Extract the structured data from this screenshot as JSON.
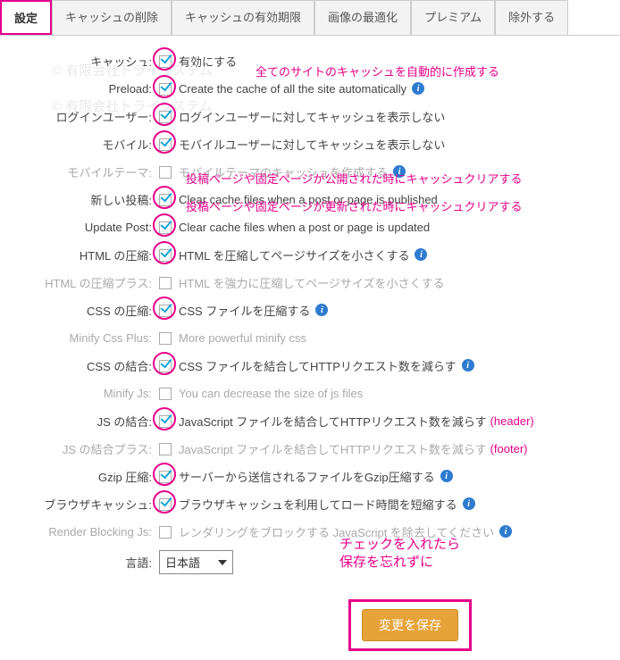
{
  "tabs": [
    {
      "label": "設定",
      "active": true
    },
    {
      "label": "キャッシュの削除",
      "active": false
    },
    {
      "label": "キャッシュの有効期限",
      "active": false
    },
    {
      "label": "画像の最適化",
      "active": false
    },
    {
      "label": "プレミアム",
      "active": false
    },
    {
      "label": "除外する",
      "active": false
    }
  ],
  "rows": [
    {
      "label": "キャッシュ:",
      "desc": "有効にする",
      "checked": true,
      "circled": true,
      "info": false,
      "disabled": false
    },
    {
      "label": "Preload:",
      "desc": "Create the cache of all the site automatically",
      "checked": true,
      "circled": true,
      "info": true,
      "disabled": false
    },
    {
      "label": "ログインユーザー:",
      "desc": "ログインユーザーに対してキャッシュを表示しない",
      "checked": true,
      "circled": true,
      "info": false,
      "disabled": false
    },
    {
      "label": "モバイル:",
      "desc": "モバイルユーザーに対してキャッシュを表示しない",
      "checked": true,
      "circled": true,
      "info": false,
      "disabled": false
    },
    {
      "label": "モバイルテーマ:",
      "desc": "モバイルテーマのキャッシュを作成する",
      "checked": false,
      "circled": false,
      "info": true,
      "disabled": true
    },
    {
      "label": "新しい投稿:",
      "desc": "Clear cache files when a post or page is published",
      "checked": true,
      "circled": true,
      "info": false,
      "disabled": false
    },
    {
      "label": "Update Post:",
      "desc": "Clear cache files when a post or page is updated",
      "checked": true,
      "circled": true,
      "info": false,
      "disabled": false
    },
    {
      "label": "HTML の圧縮:",
      "desc": "HTML を圧縮してページサイズを小さくする",
      "checked": true,
      "circled": true,
      "info": true,
      "disabled": false
    },
    {
      "label": "HTML の圧縮プラス:",
      "desc": "HTML を強力に圧縮してページサイズを小さくする",
      "checked": false,
      "circled": false,
      "info": false,
      "disabled": true
    },
    {
      "label": "CSS の圧縮:",
      "desc": "CSS ファイルを圧縮する",
      "checked": true,
      "circled": true,
      "info": true,
      "disabled": false
    },
    {
      "label": "Minify Css Plus:",
      "desc": "More powerful minify css",
      "checked": false,
      "circled": false,
      "info": false,
      "disabled": true
    },
    {
      "label": "CSS の結合:",
      "desc": "CSS ファイルを結合してHTTPリクエスト数を減らす",
      "checked": true,
      "circled": true,
      "info": true,
      "disabled": false
    },
    {
      "label": "Minify Js:",
      "desc": "You can decrease the size of js files",
      "checked": false,
      "circled": false,
      "info": false,
      "disabled": true
    },
    {
      "label": "JS の結合:",
      "desc": "JavaScript ファイルを結合してHTTPリクエスト数を減らす",
      "checked": true,
      "circled": true,
      "info": false,
      "disabled": false,
      "note": "(header)"
    },
    {
      "label": "JS の結合プラス:",
      "desc": "JavaScript ファイルを結合してHTTPリクエスト数を減らす",
      "checked": false,
      "circled": false,
      "info": false,
      "disabled": true,
      "note": "(footer)"
    },
    {
      "label": "Gzip 圧縮:",
      "desc": "サーバーから送信されるファイルをGzip圧縮する",
      "checked": true,
      "circled": true,
      "info": true,
      "disabled": false
    },
    {
      "label": "ブラウザキャッシュ:",
      "desc": "ブラウザキャッシュを利用してロード時間を短縮する",
      "checked": true,
      "circled": true,
      "info": true,
      "disabled": false
    },
    {
      "label": "Render Blocking Js:",
      "desc": "レンダリングをブロックする JavaScript を除去してください",
      "checked": false,
      "circled": false,
      "info": true,
      "disabled": true
    }
  ],
  "language": {
    "label": "言語:",
    "value": "日本語"
  },
  "save_button": "変更を保存",
  "annotations": {
    "preload": "全てのサイトのキャッシュを自動的に作成する",
    "newpost": "投稿ページや固定ページが公開された時にキャッシュクリアする",
    "updatepost": "投稿ページや固定ページが更新された時にキャッシュクリアする",
    "save1": "チェックを入れたら",
    "save2": "保存を忘れずに"
  },
  "watermarks": {
    "w1": "© 有限会社トライシステム",
    "w2": "© 有限会社トライシステム"
  }
}
